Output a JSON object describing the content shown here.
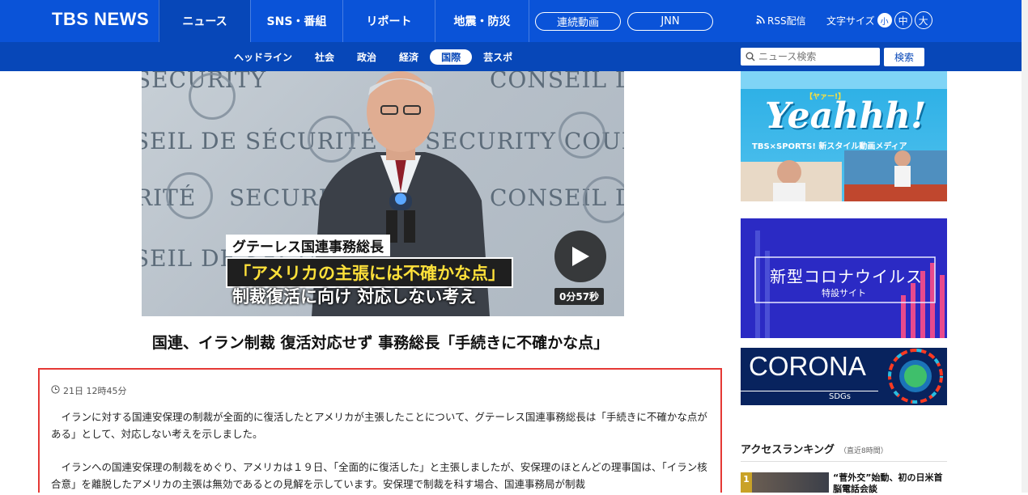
{
  "header": {
    "logo": "TBS NEWS",
    "nav": [
      "ニュース",
      "SNS・番組",
      "リポート",
      "地震・防災"
    ],
    "pills": [
      "連続動画",
      "JNN"
    ],
    "rss": "RSS配信",
    "font_size_label": "文字サイズ",
    "font_sizes": [
      "小",
      "中",
      "大"
    ]
  },
  "subnav": {
    "items": [
      "ヘッドライン",
      "社会",
      "政治",
      "経済",
      "国際",
      "芸スポ"
    ],
    "active": "国際"
  },
  "search": {
    "placeholder": "ニュース検索",
    "button": "検索"
  },
  "video": {
    "backdrop": [
      "SECURITY",
      "CONSEIL DE",
      "SEIL DE SÉCURITÉ",
      "SECURITY COUNCIL",
      "RITÉ",
      "SECURITY",
      "CONSEIL DE S",
      "SEIL DE SÉCURITÉ"
    ],
    "caption_name": "グテーレス国連事務総長",
    "caption_quote": "「アメリカの主張には不確かな点」",
    "caption_sub": "制裁復活に向け 対応しない考え",
    "duration": "0分57秒"
  },
  "article": {
    "headline": "国連、イラン制裁 復活対応せず 事務総長「手続きに不確かな点」",
    "date": "21日 12時45分",
    "paragraphs": [
      "イランに対する国連安保理の制裁が全面的に復活したとアメリカが主張したことについて、グテーレス国連事務総長は「手続きに不確かな点がある」として、対応しない考えを示しました。",
      "イランへの国連安保理の制裁をめぐり、アメリカは１９日、「全面的に復活した」と主張しましたが、安保理のほとんどの理事国は、「イラン核合意」を離脱したアメリカの主張は無効であるとの見解を示しています。安保理で制裁を科す場合、国連事務局が制裁"
    ]
  },
  "sidebar": {
    "ad1": {
      "title": "Yeahhh!",
      "ruby": "【ヤァー!】",
      "tagline": "TBS×SPORTS! 新スタイル動画メディア"
    },
    "ad2": {
      "title": "新型コロナウイルス",
      "subtitle": "特設サイト"
    },
    "ad3": {
      "title": "CORONA",
      "subtitle": "SDGs"
    },
    "ranking": {
      "title": "アクセスランキング",
      "note": "（直近8時間）",
      "items": [
        {
          "rank": "1",
          "title": "“菅外交”始動、初の日米首脳電話会談"
        }
      ]
    }
  },
  "colors": {
    "brand": "#0a53d8",
    "subnav": "#0747b8",
    "highlight": "#e53935"
  }
}
